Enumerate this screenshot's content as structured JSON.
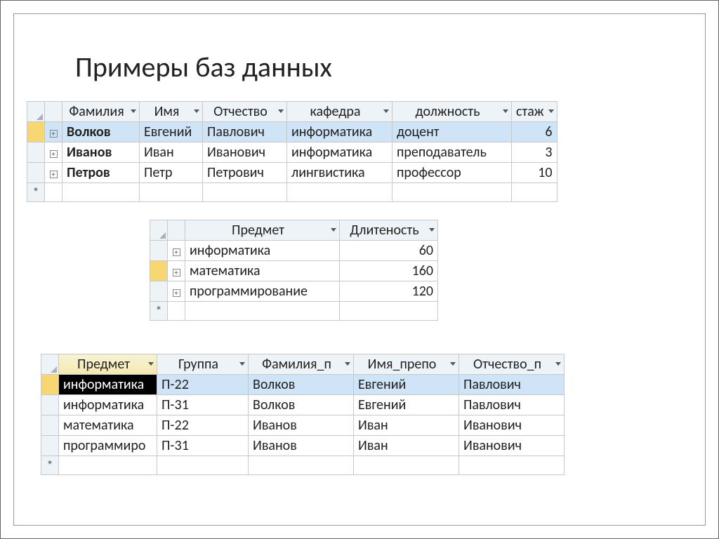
{
  "title": "Примеры баз данных",
  "table1": {
    "headers": {
      "c0": "Фамилия",
      "c1": "Имя",
      "c2": "Отчество",
      "c3": "кафедра",
      "c4": "должность",
      "c5": "стаж"
    },
    "rows": [
      {
        "c0": "Волков",
        "c1": "Евгений",
        "c2": "Павлович",
        "c3": "информатика",
        "c4": "доцент",
        "c5": "6"
      },
      {
        "c0": "Иванов",
        "c1": "Иван",
        "c2": "Иванович",
        "c3": "информатика",
        "c4": "преподаватель",
        "c5": "3"
      },
      {
        "c0": "Петров",
        "c1": "Петр",
        "c2": "Петрович",
        "c3": "лингвистика",
        "c4": "профессор",
        "c5": "10"
      }
    ],
    "new_marker": "*"
  },
  "table2": {
    "headers": {
      "c0": "Предмет",
      "c1": "Длитеность"
    },
    "rows": [
      {
        "c0": "информатика",
        "c1": "60"
      },
      {
        "c0": "математика",
        "c1": "160"
      },
      {
        "c0": "программирование",
        "c1": "120"
      }
    ],
    "new_marker": "*"
  },
  "table3": {
    "headers": {
      "c0": "Предмет",
      "c1": "Группа",
      "c2": "Фамилия_п",
      "c3": "Имя_препо",
      "c4": "Отчество_п"
    },
    "rows": [
      {
        "c0": "информатика",
        "c1": "П-22",
        "c2": "Волков",
        "c3": "Евгений",
        "c4": "Павлович"
      },
      {
        "c0": "информатика",
        "c1": "П-31",
        "c2": "Волков",
        "c3": "Евгений",
        "c4": "Павлович"
      },
      {
        "c0": "математика",
        "c1": "П-22",
        "c2": "Иванов",
        "c3": "Иван",
        "c4": "Иванович"
      },
      {
        "c0": "программиро",
        "c1": "П-31",
        "c2": "Иванов",
        "c3": "Иван",
        "c4": "Иванович"
      }
    ],
    "new_marker": "*"
  }
}
